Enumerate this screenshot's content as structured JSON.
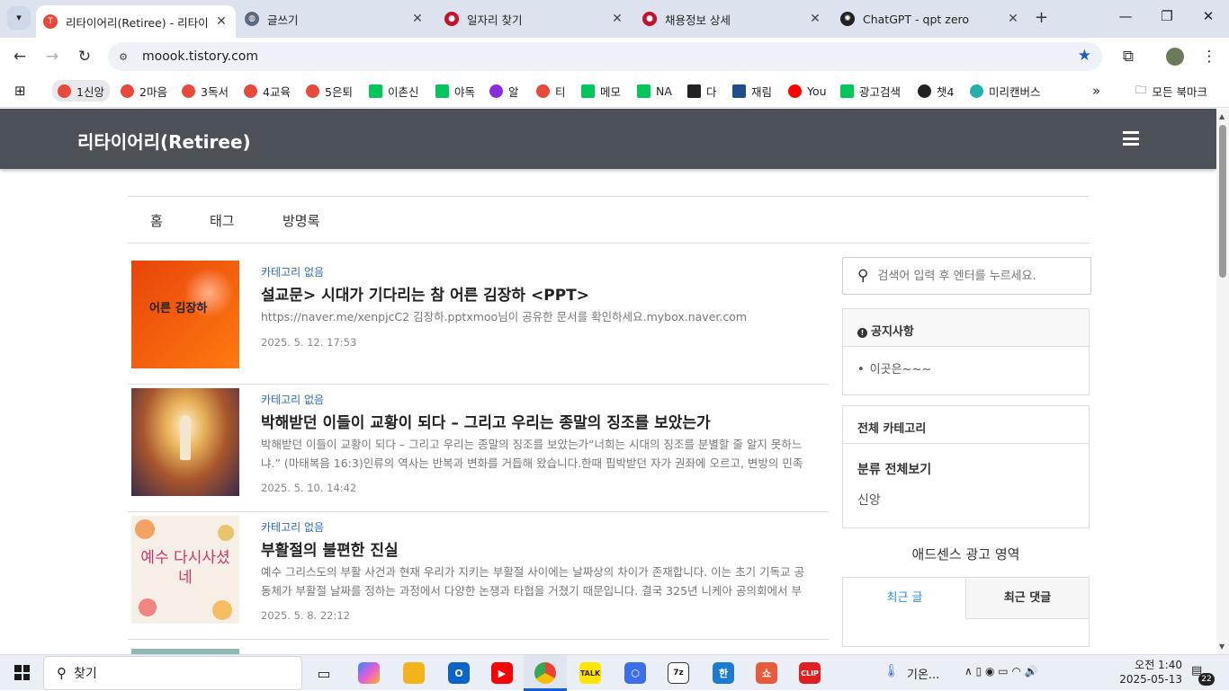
{
  "browser": {
    "tabs": [
      {
        "title": "리타이어리(Retiree) - 리타이",
        "active": true,
        "favicon_color": "#e8493a"
      },
      {
        "title": "글쓰기",
        "active": false,
        "favicon_color": "#5a6b80"
      },
      {
        "title": "일자리 찾기",
        "active": false,
        "favicon_color": "#c8102e"
      },
      {
        "title": "채용정보 상세",
        "active": false,
        "favicon_color": "#c8102e"
      },
      {
        "title": "ChatGPT - qpt zero",
        "active": false,
        "favicon_color": "#222222"
      }
    ],
    "url": "moook.tistory.com",
    "bookmarks": [
      {
        "label": "1신앙",
        "color": "#e8493a",
        "icon": "tistory-icon"
      },
      {
        "label": "2마음",
        "color": "#e8493a",
        "icon": "tistory-icon"
      },
      {
        "label": "3독서",
        "color": "#e8493a",
        "icon": "tistory-icon"
      },
      {
        "label": "4교육",
        "color": "#e8493a",
        "icon": "tistory-icon"
      },
      {
        "label": "5은퇴",
        "color": "#e8493a",
        "icon": "tistory-icon"
      },
      {
        "label": "이촌신",
        "color": "#03c75a",
        "icon": "blog-icon"
      },
      {
        "label": "야독",
        "color": "#03c75a",
        "icon": "blog-icon"
      },
      {
        "label": "알",
        "color": "#8a2be2",
        "icon": "app-icon"
      },
      {
        "label": "티",
        "color": "#e8493a",
        "icon": "tistory-icon"
      },
      {
        "label": "메모",
        "color": "#03c75a",
        "icon": "naver-icon"
      },
      {
        "label": "NA",
        "color": "#03c75a",
        "icon": "naver-icon"
      },
      {
        "label": "다",
        "color": "#222222",
        "icon": "daum-icon"
      },
      {
        "label": "재림",
        "color": "#1f4e8c",
        "icon": "site-icon"
      },
      {
        "label": "You",
        "color": "#ff0000",
        "icon": "youtube-icon"
      },
      {
        "label": "광고검색",
        "color": "#03c75a",
        "icon": "naver-icon"
      },
      {
        "label": "챗4",
        "color": "#222222",
        "icon": "chatgpt-icon"
      },
      {
        "label": "미리캔버스",
        "color": "#20b2aa",
        "icon": "miricanvas-icon"
      }
    ],
    "all_bookmarks": "모든 북마크"
  },
  "blog": {
    "title": "리타이어리(Retiree)",
    "nav": [
      "홈",
      "태그",
      "방명록"
    ],
    "search_placeholder": "검색어 입력 후 엔터를 누르세요.",
    "notice": {
      "heading": "공지사항",
      "items": [
        "이곳은~~~"
      ]
    },
    "category": {
      "heading": "전체 카테고리",
      "all": "분류 전체보기",
      "items": [
        "신앙"
      ]
    },
    "ad_text": "애드센스 광고 영역",
    "recent_tabs": [
      "최근 글",
      "최근 댓글"
    ]
  },
  "posts": [
    {
      "category": "카테고리 없음",
      "title": "설교문> 시대가 기다리는 참 어른 김장하 <PPT>",
      "excerpt": "https://naver.me/xenpjcC2 김장하.pptxmoo님이 공유한 문서를 확인하세요.mybox.naver.com",
      "date": "2025. 5. 12. 17:53",
      "thumb_text": "어른 김장하",
      "thumb_color": "#f05a0a"
    },
    {
      "category": "카테고리 없음",
      "title": "박해받던 이들이 교황이 되다 – 그리고 우리는 종말의 징조를 보았는가",
      "excerpt": "박해받던 이들이 교황이 되다 – 그리고 우리는 종말의 징조를 보았는가“너희는 시대의 징조를 분별할 줄 알지 못하느냐.” (마태복음 16:3)인류의 역사는 반복과 변화를 거듭해 왔습니다.한때 핍박받던 자가 권좌에 오르고, 변방의 민족",
      "date": "2025. 5. 10. 14:42",
      "thumb_text": "",
      "thumb_color": "#7a4a2a"
    },
    {
      "category": "카테고리 없음",
      "title": "부활절의 불편한 진실",
      "excerpt": "예수 그리스도의 부활 사건과 현재 우리가 지키는 부활절 사이에는 날짜상의 차이가 존재합니다. 이는 초기 기독교 공동체가 부활절 날짜를 정하는 과정에서 다양한 논쟁과 타협을 거쳤기 때문입니다. 결국 325년 니케아 공의회에서 부",
      "date": "2025. 5. 8. 22:12",
      "thumb_text": "예수 다시사셨네",
      "thumb_color": "#f6efe6"
    }
  ],
  "taskbar": {
    "search_label": "찾기",
    "weather": "기온...",
    "time": "오전 1:40",
    "date": "2025-05-13",
    "notifications": "22"
  }
}
